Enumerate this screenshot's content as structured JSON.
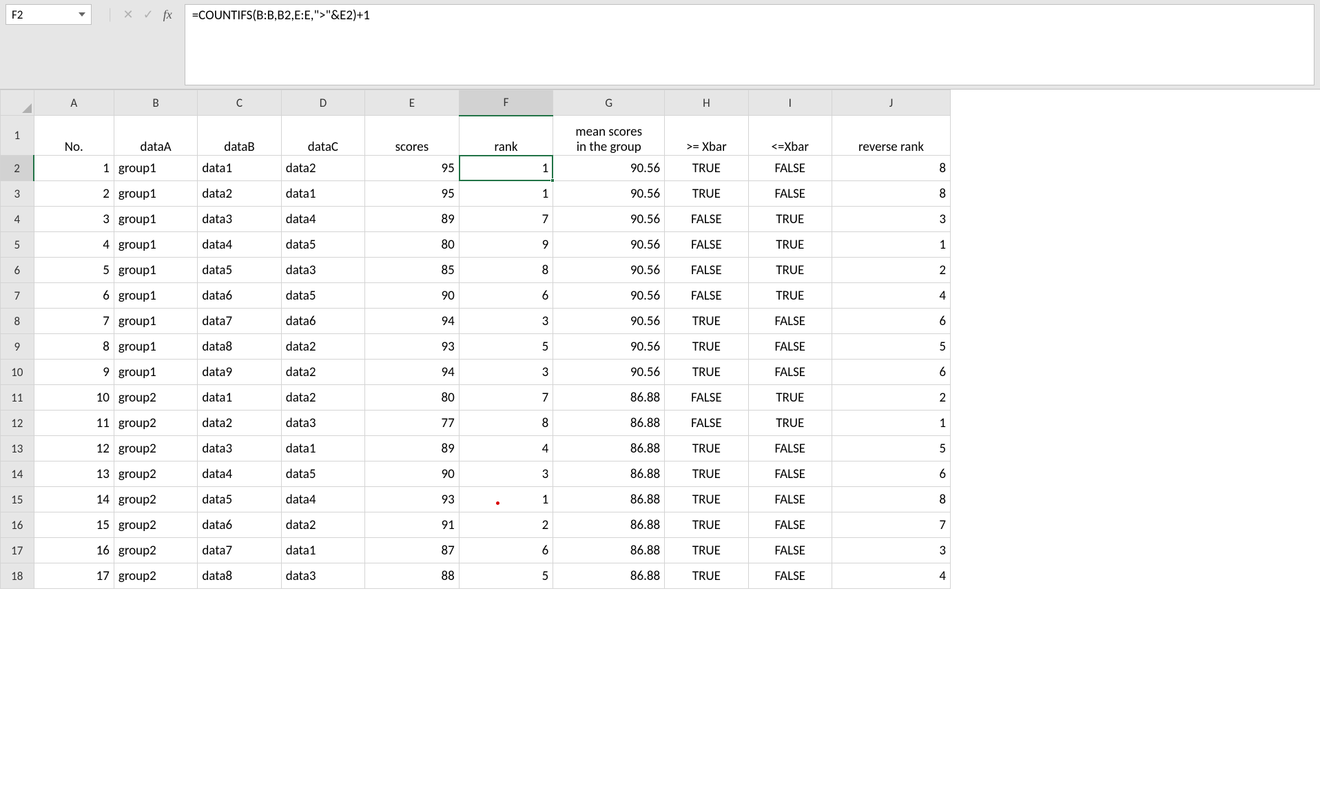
{
  "name_box": "F2",
  "formula": "=COUNTIFS(B:B,B2,E:E,\">\"&E2)+1",
  "active_cell": {
    "row": 2,
    "col": "F"
  },
  "columns": [
    "A",
    "B",
    "C",
    "D",
    "E",
    "F",
    "G",
    "H",
    "I",
    "J"
  ],
  "headers": {
    "A": "No.",
    "B": "dataA",
    "C": "dataB",
    "D": "dataC",
    "E": "scores",
    "F": "rank",
    "G_top": "mean scores",
    "G": "in the group",
    "H": ">= Xbar",
    "I": "<=Xbar",
    "J": "reverse rank"
  },
  "rows": [
    {
      "n": 1,
      "A": "group1",
      "B": "data1",
      "C": "data2",
      "E": 95,
      "F": 1,
      "G": "90.56",
      "H": "TRUE",
      "I": "FALSE",
      "J": 8
    },
    {
      "n": 2,
      "A": "group1",
      "B": "data2",
      "C": "data1",
      "E": 95,
      "F": 1,
      "G": "90.56",
      "H": "TRUE",
      "I": "FALSE",
      "J": 8
    },
    {
      "n": 3,
      "A": "group1",
      "B": "data3",
      "C": "data4",
      "E": 89,
      "F": 7,
      "G": "90.56",
      "H": "FALSE",
      "I": "TRUE",
      "J": 3
    },
    {
      "n": 4,
      "A": "group1",
      "B": "data4",
      "C": "data5",
      "E": 80,
      "F": 9,
      "G": "90.56",
      "H": "FALSE",
      "I": "TRUE",
      "J": 1
    },
    {
      "n": 5,
      "A": "group1",
      "B": "data5",
      "C": "data3",
      "E": 85,
      "F": 8,
      "G": "90.56",
      "H": "FALSE",
      "I": "TRUE",
      "J": 2
    },
    {
      "n": 6,
      "A": "group1",
      "B": "data6",
      "C": "data5",
      "E": 90,
      "F": 6,
      "G": "90.56",
      "H": "FALSE",
      "I": "TRUE",
      "J": 4
    },
    {
      "n": 7,
      "A": "group1",
      "B": "data7",
      "C": "data6",
      "E": 94,
      "F": 3,
      "G": "90.56",
      "H": "TRUE",
      "I": "FALSE",
      "J": 6
    },
    {
      "n": 8,
      "A": "group1",
      "B": "data8",
      "C": "data2",
      "E": 93,
      "F": 5,
      "G": "90.56",
      "H": "TRUE",
      "I": "FALSE",
      "J": 5
    },
    {
      "n": 9,
      "A": "group1",
      "B": "data9",
      "C": "data2",
      "E": 94,
      "F": 3,
      "G": "90.56",
      "H": "TRUE",
      "I": "FALSE",
      "J": 6
    },
    {
      "n": 10,
      "A": "group2",
      "B": "data1",
      "C": "data2",
      "E": 80,
      "F": 7,
      "G": "86.88",
      "H": "FALSE",
      "I": "TRUE",
      "J": 2
    },
    {
      "n": 11,
      "A": "group2",
      "B": "data2",
      "C": "data3",
      "E": 77,
      "F": 8,
      "G": "86.88",
      "H": "FALSE",
      "I": "TRUE",
      "J": 1
    },
    {
      "n": 12,
      "A": "group2",
      "B": "data3",
      "C": "data1",
      "E": 89,
      "F": 4,
      "G": "86.88",
      "H": "TRUE",
      "I": "FALSE",
      "J": 5
    },
    {
      "n": 13,
      "A": "group2",
      "B": "data4",
      "C": "data5",
      "E": 90,
      "F": 3,
      "G": "86.88",
      "H": "TRUE",
      "I": "FALSE",
      "J": 6
    },
    {
      "n": 14,
      "A": "group2",
      "B": "data5",
      "C": "data4",
      "E": 93,
      "F": 1,
      "G": "86.88",
      "H": "TRUE",
      "I": "FALSE",
      "J": 8
    },
    {
      "n": 15,
      "A": "group2",
      "B": "data6",
      "C": "data2",
      "E": 91,
      "F": 2,
      "G": "86.88",
      "H": "TRUE",
      "I": "FALSE",
      "J": 7
    },
    {
      "n": 16,
      "A": "group2",
      "B": "data7",
      "C": "data1",
      "E": 87,
      "F": 6,
      "G": "86.88",
      "H": "TRUE",
      "I": "FALSE",
      "J": 3
    },
    {
      "n": 17,
      "A": "group2",
      "B": "data8",
      "C": "data3",
      "E": 88,
      "F": 5,
      "G": "86.88",
      "H": "TRUE",
      "I": "FALSE",
      "J": 4
    }
  ]
}
